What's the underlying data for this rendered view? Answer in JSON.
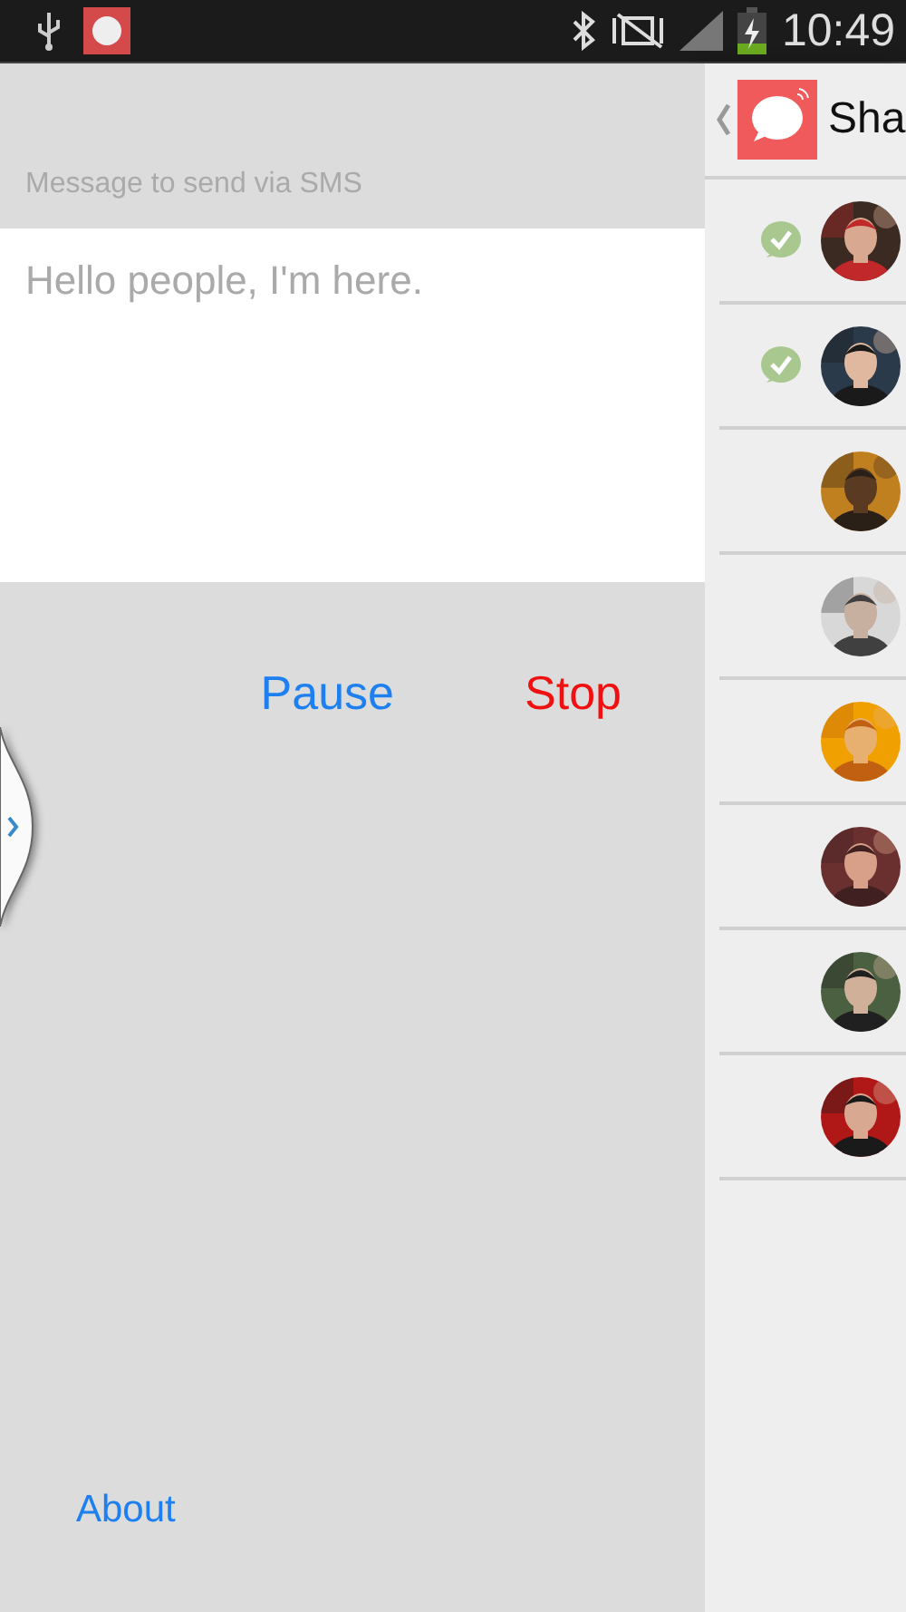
{
  "status_bar": {
    "time": "10:49"
  },
  "message": {
    "label": "Message to send via SMS",
    "placeholder": "Hello people, I'm here."
  },
  "buttons": [
    {
      "label": "Pause",
      "kind": "pause"
    },
    {
      "label": "Stop",
      "kind": "stop"
    }
  ],
  "about_link": "About",
  "panel": {
    "title": "Sha",
    "contacts": [
      {
        "delivered": true,
        "kind": "picture"
      },
      {
        "delivered": true,
        "kind": "picture"
      },
      {
        "delivered": false,
        "kind": "picture"
      },
      {
        "delivered": false,
        "kind": "picture"
      },
      {
        "delivered": false,
        "kind": "picture"
      },
      {
        "delivered": false,
        "kind": "picture"
      },
      {
        "delivered": false,
        "kind": "picture"
      },
      {
        "delivered": false,
        "kind": "picture"
      }
    ]
  }
}
